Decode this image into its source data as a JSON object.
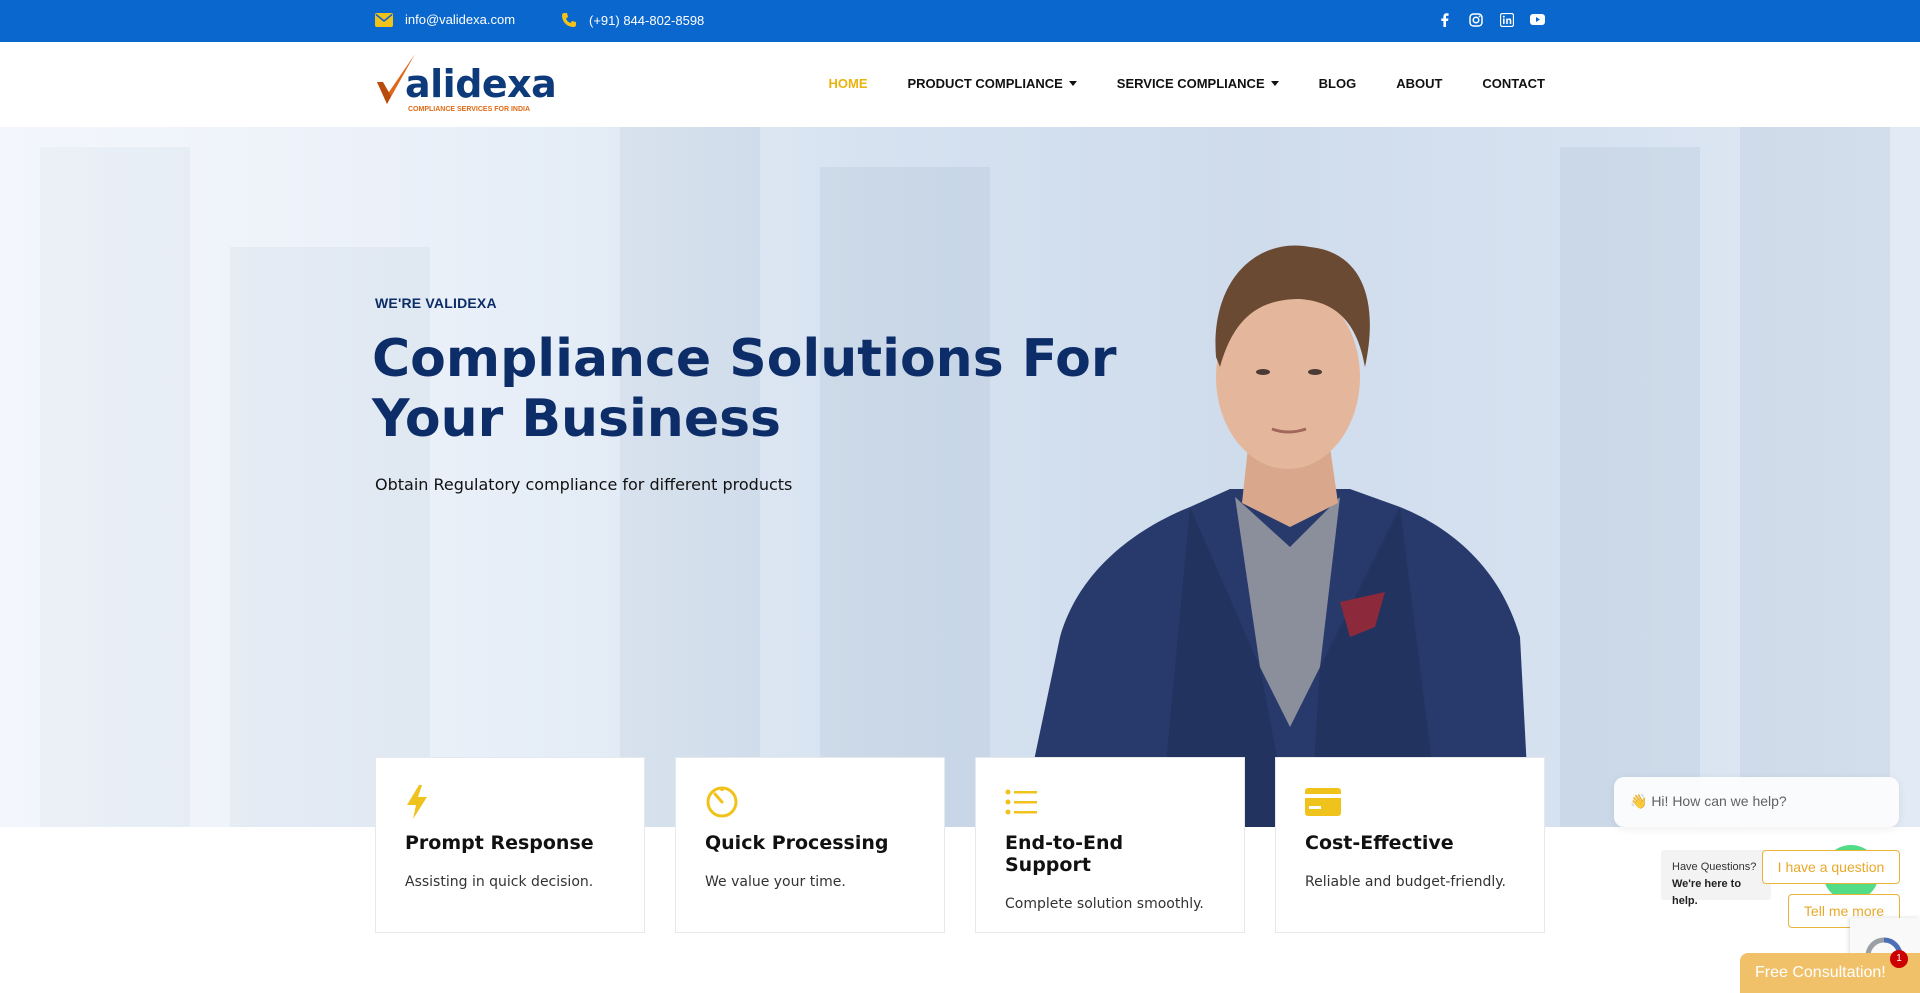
{
  "topbar": {
    "email": "info@validexa.com",
    "phone": "(+91) 844-802-8598",
    "email_icon": "envelope-icon",
    "phone_icon": "phone-icon",
    "social": [
      "facebook-icon",
      "instagram-icon",
      "linkedin-icon",
      "youtube-icon"
    ],
    "bg_color": "#0a67cd"
  },
  "logo": {
    "word": "alidexa",
    "tagline": "COMPLIANCE SERVICES FOR INDIA"
  },
  "nav": {
    "items": [
      {
        "label": "HOME",
        "active": true
      },
      {
        "label": "PRODUCT COMPLIANCE",
        "dropdown": true
      },
      {
        "label": "SERVICE COMPLIANCE",
        "dropdown": true
      },
      {
        "label": "BLOG"
      },
      {
        "label": "ABOUT"
      },
      {
        "label": "CONTACT"
      }
    ],
    "active_color": "#e9b40f"
  },
  "hero": {
    "eyebrow": "WE'RE VALIDEXA",
    "headline": "Compliance Solutions For Your Business",
    "subline": "Obtain Regulatory compliance for different products",
    "text_color": "#0c2d68"
  },
  "features": [
    {
      "icon": "lightning-bolt-icon",
      "title": "Prompt Response",
      "desc": "Assisting in quick decision."
    },
    {
      "icon": "stopwatch-icon",
      "title": "Quick Processing",
      "desc": "We value your time."
    },
    {
      "icon": "list-icon",
      "title": "End-to-End Support",
      "desc": "Complete solution smoothly."
    },
    {
      "icon": "credit-card-icon",
      "title": "Cost-Effective",
      "desc": "Reliable and budget-friendly."
    }
  ],
  "chat": {
    "greeting": "👋 Hi! How can we help?",
    "have_questions": "Have Questions?",
    "here_to_help": "We're here to help.",
    "option1": "I have a question",
    "option2": "Tell me more",
    "free_consultation": "Free Consultation!",
    "badge_count": "1"
  },
  "accent_color": "#e9b40f"
}
